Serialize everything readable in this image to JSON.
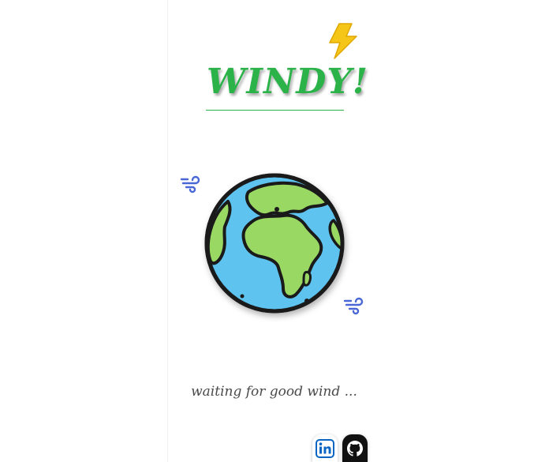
{
  "app": {
    "title": "WINDY!",
    "tagline": "waiting for good wind ..."
  },
  "colors": {
    "title_green": "#2bb34a",
    "bolt_yellow": "#f5c518",
    "ocean_blue": "#5ec3ef",
    "land_green": "#9ad864",
    "wind_blue": "#4a67d6",
    "linkedin_blue": "#0a66c2",
    "github_black": "#111111"
  },
  "icons": {
    "bolt": "lightning-bolt-icon",
    "globe": "earth-globe-icon",
    "wind": "wind-icon",
    "linkedin": "linkedin-icon",
    "github": "github-icon"
  }
}
